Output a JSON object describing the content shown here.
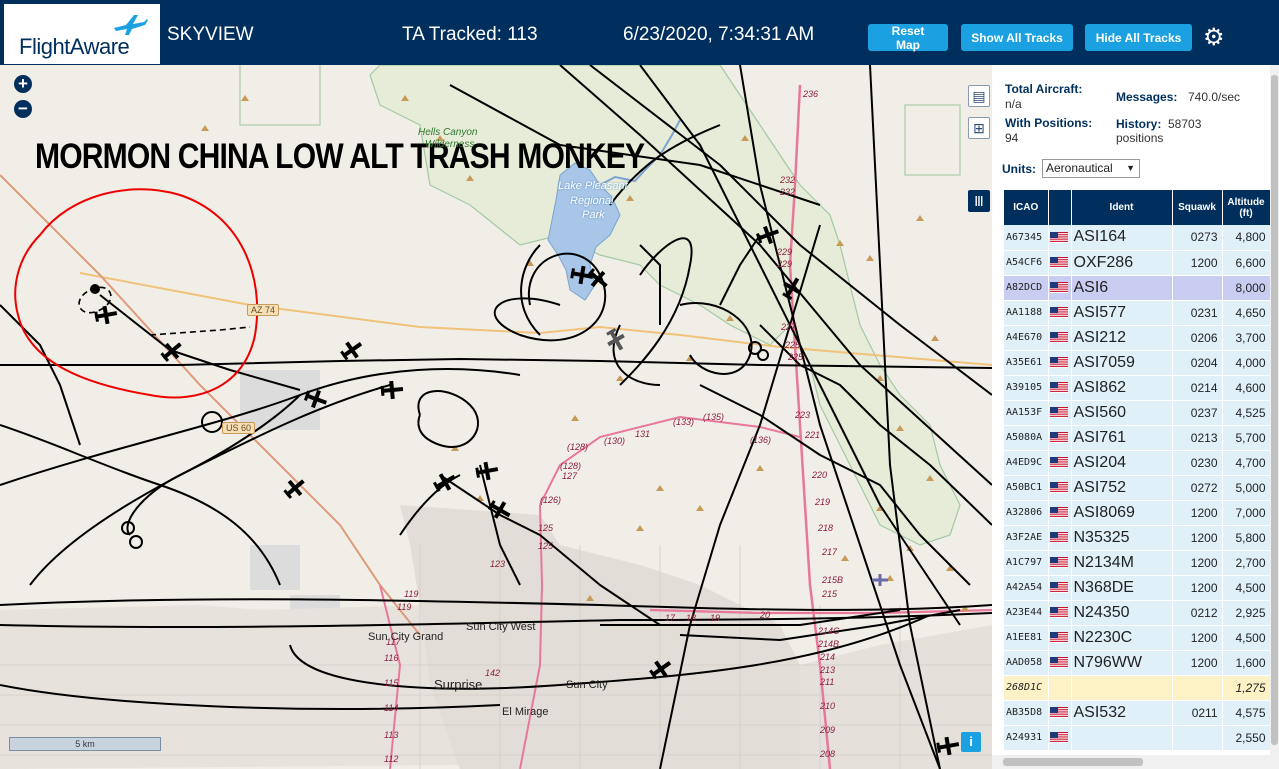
{
  "header": {
    "logo_text": "FlightAware",
    "app_name": "SKYVIEW",
    "ta_tracked": "TA Tracked: 113",
    "datetime": "6/23/2020, 7:34:31 AM",
    "reset_label": "Reset Map",
    "show_all_label": "Show All Tracks",
    "hide_all_label": "Hide All Tracks",
    "settings_icon": "gear-icon",
    "brand_color": "#002f5d",
    "button_color": "#1ba1e2"
  },
  "map": {
    "overlay_title": "MORMON CHINA LOW ALT TRASH MONKEY",
    "zoom_in": "+",
    "zoom_out": "−",
    "scale_text": "5 km",
    "info": "i",
    "labels": {
      "hells_canyon": "Hells Canyon",
      "wilderness": "Wilderness",
      "lake_pleasant": "Lake Pleasant",
      "regional": "Regional",
      "park": "Park",
      "sun_city_grand": "Sun City Grand",
      "sun_city_west": "Sun City West",
      "surprise": "Surprise",
      "sun_city": "Sun City",
      "el_mirage": "El Mirage"
    },
    "highways": {
      "az74": "AZ 74",
      "us60": "US 60"
    },
    "routes": [
      "236",
      "232",
      "232",
      "229",
      "229",
      "227",
      "225",
      "225",
      "223",
      "221",
      "220",
      "219",
      "218",
      "217",
      "215B",
      "215",
      "214C",
      "214B",
      "214",
      "213",
      "211",
      "210",
      "209",
      "208",
      "(128)",
      "(128)",
      "127",
      "(126)",
      "125",
      "125",
      "123",
      "(130)",
      "131",
      "(133)",
      "(135)",
      "(136)",
      "119",
      "119",
      "117",
      "116",
      "115",
      "114",
      "113",
      "112",
      "142",
      "20",
      "17",
      "18",
      "19"
    ]
  },
  "stats": {
    "total_label": "Total Aircraft:",
    "total_value": "n/a",
    "positions_label": "With Positions:",
    "positions_value": "94",
    "messages_label": "Messages:",
    "messages_value": "740.0/sec",
    "history_label": "History:",
    "history_value": "58703",
    "history_unit": "positions",
    "units_label": "Units:",
    "units_value": "Aeronautical"
  },
  "table": {
    "headers": [
      "ICAO",
      "",
      "Ident",
      "Squawk",
      "Altitude (ft)"
    ],
    "rows": [
      {
        "icao": "A67345",
        "ident": "ASI164",
        "squawk": "0273",
        "alt": "4,800"
      },
      {
        "icao": "A54CF6",
        "ident": "OXF286",
        "squawk": "1200",
        "alt": "6,600"
      },
      {
        "icao": "A82DCD",
        "ident": "ASI6",
        "squawk": "",
        "alt": "8,000"
      },
      {
        "icao": "AA1188",
        "ident": "ASI577",
        "squawk": "0231",
        "alt": "4,650"
      },
      {
        "icao": "A4E670",
        "ident": "ASI212",
        "squawk": "0206",
        "alt": "3,700"
      },
      {
        "icao": "A35E61",
        "ident": "ASI7059",
        "squawk": "0204",
        "alt": "4,000"
      },
      {
        "icao": "A39105",
        "ident": "ASI862",
        "squawk": "0214",
        "alt": "4,600"
      },
      {
        "icao": "AA153F",
        "ident": "ASI560",
        "squawk": "0237",
        "alt": "4,525"
      },
      {
        "icao": "A5080A",
        "ident": "ASI761",
        "squawk": "0213",
        "alt": "5,700"
      },
      {
        "icao": "A4ED9C",
        "ident": "ASI204",
        "squawk": "0230",
        "alt": "4,700"
      },
      {
        "icao": "A50BC1",
        "ident": "ASI752",
        "squawk": "0272",
        "alt": "5,000"
      },
      {
        "icao": "A32806",
        "ident": "ASI8069",
        "squawk": "1200",
        "alt": "7,000"
      },
      {
        "icao": "A3F2AE",
        "ident": "N35325",
        "squawk": "1200",
        "alt": "5,800"
      },
      {
        "icao": "A1C797",
        "ident": "N2134M",
        "squawk": "1200",
        "alt": "2,700"
      },
      {
        "icao": "A42A54",
        "ident": "N368DE",
        "squawk": "1200",
        "alt": "4,500"
      },
      {
        "icao": "A23E44",
        "ident": "N24350",
        "squawk": "0212",
        "alt": "2,925"
      },
      {
        "icao": "A1EE81",
        "ident": "N2230C",
        "squawk": "1200",
        "alt": "4,500"
      },
      {
        "icao": "AAD058",
        "ident": "N796WW",
        "squawk": "1200",
        "alt": "1,600"
      },
      {
        "icao": "268D1C",
        "ident": "",
        "squawk": "",
        "alt": "1,275"
      },
      {
        "icao": "AB35D8",
        "ident": "ASI532",
        "squawk": "0211",
        "alt": "4,575"
      },
      {
        "icao": "A24931",
        "ident": "",
        "squawk": "",
        "alt": "2,550"
      }
    ]
  }
}
